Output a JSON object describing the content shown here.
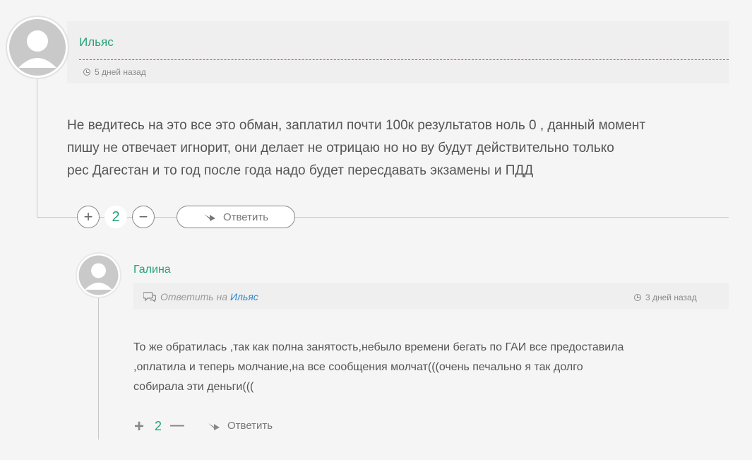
{
  "comment": {
    "author": "Ильяс",
    "time": "5 дней назад",
    "text_lines": [
      "Не ведитесь на это все это обман, заплатил почти 100к результатов ноль 0 , данный момент",
      "пишу не отвечает игнорит, они делает не отрицаю но но ву будут действительно только",
      "рес Дагестан и то год после года надо будет пересдавать экзамены и ПДД"
    ],
    "votes": "2",
    "plus": "+",
    "minus": "−",
    "reply_label": "Ответить"
  },
  "reply": {
    "author": "Галина",
    "reply_to_prefix": "Ответить на",
    "reply_to_name": "Ильяс",
    "time": "3 дней назад",
    "text_lines": [
      "То же обратилась ,так как полна занятость,небыло времени бегать по ГАИ все предоставила",
      ",оплатила и теперь молчание,на все сообщения молчат(((очень печально я так долго",
      "собирала эти деньги((("
    ],
    "votes": "2",
    "plus": "+",
    "minus": "—",
    "reply_label": "Ответить"
  },
  "colors": {
    "accent": "#27a17a",
    "link": "#2f86c8",
    "text": "#555555",
    "muted": "#888888"
  }
}
